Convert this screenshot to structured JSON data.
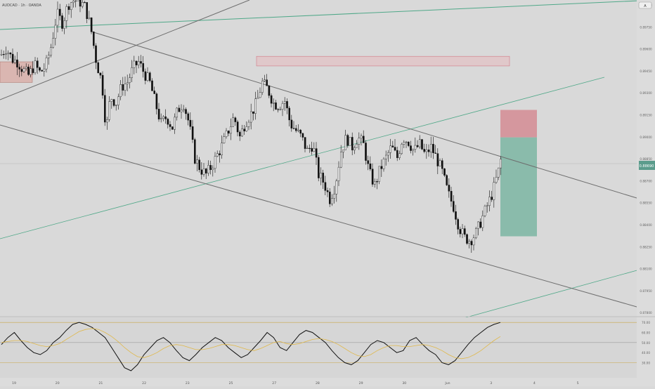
{
  "header": {
    "symbol_label": "AUDCAD · 1h · OANDA",
    "corner_button": "A"
  },
  "colors": {
    "background": "#d9d9d9",
    "candle_up": "#f2f2f2",
    "candle_down": "#111111",
    "trendline": "#6e6e6e",
    "green_line": "#4fa888",
    "stop_zone": "#d5949b",
    "target_zone": "#86b9a9",
    "supply_zone": "#e6b9be",
    "demand_zone": "#d9aca6",
    "rsi_line": "#111111",
    "rsi_ma": "#e0b84a"
  },
  "chart_data": [
    {
      "type": "candlestick",
      "title": "",
      "price_scale": {
        "ylim": [
          0.8765,
          0.8995
        ],
        "ticks": [
          "0.89900",
          "0.89750",
          "0.89600",
          "0.89450",
          "0.89300",
          "0.89150",
          "0.89000",
          "0.88850",
          "0.88700",
          "0.88550",
          "0.88400",
          "0.88250",
          "0.88100",
          "0.87950",
          "0.87800"
        ],
        "current_price_label": "0.88690"
      },
      "time_axis": {
        "ticks": [
          "19",
          "20",
          "21",
          "22",
          "23",
          "25",
          "27",
          "28",
          "29",
          "30",
          "Jun",
          "3",
          "4",
          "5"
        ]
      },
      "price_path": [
        [
          0,
          0.8955
        ],
        [
          8,
          0.896
        ],
        [
          16,
          0.8952
        ],
        [
          24,
          0.895
        ],
        [
          32,
          0.8944
        ],
        [
          40,
          0.894
        ],
        [
          48,
          0.8948
        ],
        [
          56,
          0.8942
        ],
        [
          64,
          0.8947
        ],
        [
          72,
          0.8962
        ],
        [
          80,
          0.8985
        ],
        [
          88,
          0.8978
        ],
        [
          96,
          0.8992
        ],
        [
          104,
          0.8995
        ],
        [
          112,
          0.8994
        ],
        [
          120,
          0.899
        ],
        [
          128,
          0.8975
        ],
        [
          136,
          0.895
        ],
        [
          144,
          0.8935
        ],
        [
          150,
          0.89
        ],
        [
          156,
          0.8925
        ],
        [
          164,
          0.892
        ],
        [
          172,
          0.8932
        ],
        [
          180,
          0.8935
        ],
        [
          188,
          0.8945
        ],
        [
          196,
          0.895
        ],
        [
          204,
          0.8942
        ],
        [
          212,
          0.8935
        ],
        [
          220,
          0.892
        ],
        [
          228,
          0.8905
        ],
        [
          236,
          0.891
        ],
        [
          244,
          0.8902
        ],
        [
          252,
          0.8915
        ],
        [
          260,
          0.892
        ],
        [
          268,
          0.8905
        ],
        [
          276,
          0.888
        ],
        [
          284,
          0.8872
        ],
        [
          292,
          0.8868
        ],
        [
          300,
          0.8874
        ],
        [
          308,
          0.8882
        ],
        [
          316,
          0.889
        ],
        [
          324,
          0.89
        ],
        [
          332,
          0.891
        ],
        [
          340,
          0.8895
        ],
        [
          348,
          0.8906
        ],
        [
          356,
          0.8912
        ],
        [
          364,
          0.892
        ],
        [
          372,
          0.8935
        ],
        [
          380,
          0.893
        ],
        [
          388,
          0.892
        ],
        [
          396,
          0.8918
        ],
        [
          404,
          0.8922
        ],
        [
          412,
          0.8905
        ],
        [
          420,
          0.89
        ],
        [
          428,
          0.8895
        ],
        [
          436,
          0.8885
        ],
        [
          444,
          0.889
        ],
        [
          452,
          0.8868
        ],
        [
          460,
          0.8862
        ],
        [
          468,
          0.885
        ],
        [
          476,
          0.886
        ],
        [
          484,
          0.8885
        ],
        [
          492,
          0.8895
        ],
        [
          500,
          0.8888
        ],
        [
          508,
          0.8895
        ],
        [
          516,
          0.889
        ],
        [
          524,
          0.887
        ],
        [
          532,
          0.886
        ],
        [
          540,
          0.8872
        ],
        [
          548,
          0.888
        ],
        [
          556,
          0.8888
        ],
        [
          564,
          0.888
        ],
        [
          572,
          0.8895
        ],
        [
          580,
          0.8892
        ],
        [
          588,
          0.8885
        ],
        [
          596,
          0.889
        ],
        [
          604,
          0.8882
        ],
        [
          612,
          0.8888
        ],
        [
          620,
          0.888
        ],
        [
          628,
          0.887
        ],
        [
          636,
          0.8855
        ],
        [
          644,
          0.8845
        ],
        [
          652,
          0.883
        ],
        [
          660,
          0.8822
        ],
        [
          668,
          0.882
        ],
        [
          676,
          0.8825
        ],
        [
          684,
          0.8835
        ],
        [
          692,
          0.8845
        ],
        [
          700,
          0.8855
        ],
        [
          708,
          0.887
        ],
        [
          712,
          0.888
        ]
      ],
      "zones": [
        {
          "name": "supply-zone",
          "from_x": 365,
          "to_x": 725,
          "top": 0.8954,
          "bottom": 0.8947
        },
        {
          "name": "demand-zone",
          "from_x": 0,
          "to_x": 46,
          "top": 0.895,
          "bottom": 0.8935
        },
        {
          "name": "stop-zone",
          "from_x": 712,
          "to_x": 764,
          "top": 0.8915,
          "bottom": 0.8895
        },
        {
          "name": "target-zone",
          "from_x": 712,
          "to_x": 764,
          "top": 0.8895,
          "bottom": 0.8823
        }
      ]
    },
    {
      "type": "line",
      "title": "",
      "ylim": [
        15,
        75
      ],
      "ticks": [
        "70.00",
        "60.00",
        "50.00",
        "40.00",
        "30.00"
      ],
      "levels": [
        70,
        50,
        30
      ],
      "series": [
        {
          "values": [
            48,
            55,
            60,
            52,
            45,
            40,
            38,
            42,
            50,
            55,
            62,
            68,
            70,
            68,
            65,
            60,
            55,
            45,
            35,
            25,
            22,
            28,
            38,
            45,
            52,
            55,
            50,
            42,
            35,
            32,
            38,
            45,
            50,
            55,
            52,
            45,
            40,
            35,
            38,
            45,
            52,
            60,
            55,
            45,
            42,
            50,
            58,
            62,
            60,
            55,
            50,
            42,
            35,
            30,
            28,
            32,
            40,
            48,
            52,
            50,
            45,
            40,
            42,
            52,
            55,
            48,
            42,
            38,
            30,
            28,
            32,
            40,
            48,
            55,
            60,
            65,
            68,
            70
          ]
        },
        {
          "values": [
            50,
            51,
            52,
            52,
            51,
            49,
            47,
            46,
            47,
            49,
            53,
            57,
            61,
            63,
            64,
            63,
            60,
            56,
            51,
            45,
            40,
            36,
            35,
            37,
            40,
            44,
            47,
            48,
            47,
            45,
            43,
            43,
            44,
            46,
            48,
            48,
            47,
            45,
            43,
            42,
            44,
            47,
            50,
            51,
            49,
            48,
            49,
            51,
            53,
            54,
            53,
            51,
            48,
            44,
            40,
            37,
            36,
            38,
            42,
            45,
            47,
            47,
            46,
            46,
            47,
            48,
            47,
            45,
            42,
            38,
            35,
            34,
            35,
            38,
            42,
            47,
            52,
            56
          ]
        }
      ]
    }
  ]
}
